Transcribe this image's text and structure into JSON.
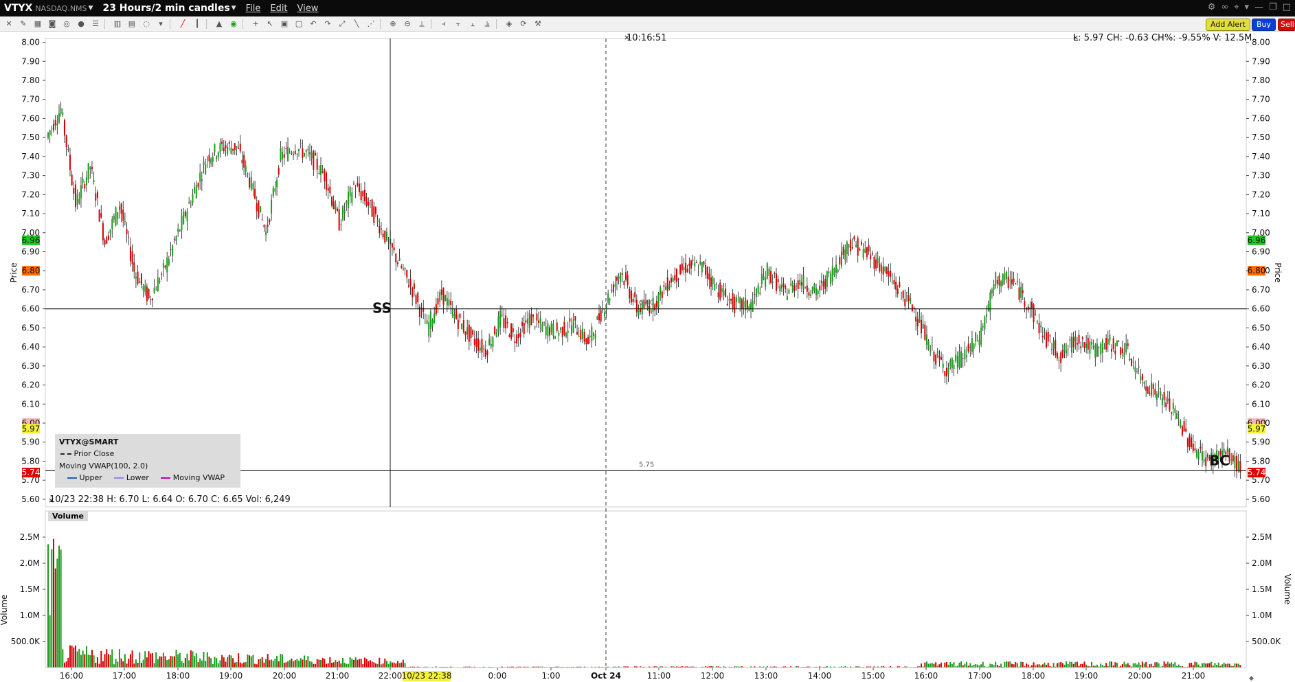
{
  "titlebar": {
    "symbol": "VTYX",
    "exchange": "NASDAQ.NMS",
    "period": "23 Hours/2 min candles",
    "menus": [
      "File",
      "Edit",
      "View"
    ]
  },
  "toolbar": {
    "add_alert": "Add Alert",
    "buy": "Buy",
    "sell": "Sell"
  },
  "chart_info": {
    "top_right": "L: 5.97  CH: -0.63  CH%: -9.55%  V: 12.5M",
    "crosshair_time": "10:16:51",
    "cursor_bar": "10/23 22:38   H: 6.70   L: 6.64   O: 6.70   C: 6.65   Vol: 6,249",
    "cursor_time_label": "10/23 22:38"
  },
  "legend": {
    "title": "VTYX@SMART",
    "prior_close": "Prior Close",
    "vwap": "Moving VWAP(100, 2.0)",
    "upper": "Upper",
    "lower": "Lower",
    "moving_vwap": "Moving VWAP"
  },
  "annotations": {
    "ss": "SS",
    "bc": "BC",
    "line_660": "6.60",
    "line_575": "5.75"
  },
  "price_axis": {
    "label": "Price",
    "ticks": [
      "8.00",
      "7.90",
      "7.80",
      "7.70",
      "7.60",
      "7.50",
      "7.40",
      "7.30",
      "7.20",
      "7.10",
      "7.00",
      "6.90",
      "6.80",
      "6.70",
      "6.60",
      "6.50",
      "6.40",
      "6.30",
      "6.20",
      "6.10",
      "6.00",
      "5.90",
      "5.80",
      "5.70",
      "5.60"
    ],
    "badges": [
      {
        "value": "6.96",
        "color": "#21c521"
      },
      {
        "value": "6.80",
        "color": "#ff6a00"
      },
      {
        "value": "6.00",
        "color": "#f4b6b6"
      },
      {
        "value": "5.97",
        "color": "#f6f23a"
      },
      {
        "value": "5.74",
        "color": "#e00000"
      }
    ]
  },
  "volume_axis": {
    "label": "Volume",
    "panel_label": "Volume",
    "ticks": [
      "2.5M",
      "2.0M",
      "1.5M",
      "1.0M",
      "500.0K"
    ]
  },
  "time_axis": {
    "ticks": [
      "16:00",
      "17:00",
      "18:00",
      "19:00",
      "20:00",
      "21:00",
      "22:00",
      "0:00",
      "1:00",
      "Oct 24",
      "11:00",
      "12:00",
      "13:00",
      "14:00",
      "15:00",
      "16:00",
      "17:00",
      "18:00",
      "19:00",
      "20:00",
      "21:00"
    ]
  },
  "colors": {
    "up": "#1a9b1a",
    "down": "#d40000",
    "background": "#ffffff",
    "titlebar": "#0b0b0b"
  },
  "chart_data": {
    "type": "candlestick",
    "price_range": [
      5.56,
      8.02
    ],
    "volume_range": [
      0,
      3000000
    ],
    "reference_lines": [
      6.6,
      5.75
    ],
    "close_path": [
      {
        "t": "15:40",
        "p": 7.5
      },
      {
        "t": "15:50",
        "p": 7.65
      },
      {
        "t": "16:00",
        "p": 7.15
      },
      {
        "t": "16:20",
        "p": 7.35
      },
      {
        "t": "16:40",
        "p": 6.95
      },
      {
        "t": "17:00",
        "p": 7.15
      },
      {
        "t": "17:10",
        "p": 6.8
      },
      {
        "t": "17:20",
        "p": 6.65
      },
      {
        "t": "17:30",
        "p": 6.8
      },
      {
        "t": "17:40",
        "p": 7.0
      },
      {
        "t": "17:50",
        "p": 7.2
      },
      {
        "t": "18:00",
        "p": 7.4
      },
      {
        "t": "18:30",
        "p": 7.45
      },
      {
        "t": "18:50",
        "p": 7.45
      },
      {
        "t": "19:00",
        "p": 7.25
      },
      {
        "t": "19:10",
        "p": 7.0
      },
      {
        "t": "19:20",
        "p": 7.4
      },
      {
        "t": "19:40",
        "p": 7.45
      },
      {
        "t": "20:00",
        "p": 7.4
      },
      {
        "t": "20:10",
        "p": 7.3
      },
      {
        "t": "20:30",
        "p": 7.05
      },
      {
        "t": "20:40",
        "p": 7.25
      },
      {
        "t": "21:00",
        "p": 7.15
      },
      {
        "t": "21:10",
        "p": 7.0
      },
      {
        "t": "21:30",
        "p": 6.85
      },
      {
        "t": "21:50",
        "p": 6.7
      },
      {
        "t": "22:00",
        "p": 6.5
      },
      {
        "t": "22:20",
        "p": 6.68
      },
      {
        "t": "22:40",
        "p": 6.55
      },
      {
        "t": "22:50",
        "p": 6.45
      },
      {
        "t": "23:20",
        "p": 6.38
      },
      {
        "t": "23:40",
        "p": 6.55
      },
      {
        "t": "0:00",
        "p": 6.45
      },
      {
        "t": "0:20",
        "p": 6.55
      },
      {
        "t": "0:40",
        "p": 6.5
      },
      {
        "t": "1:00",
        "p": 6.48
      },
      {
        "t": "1:30",
        "p": 6.52
      },
      {
        "t": "2:00",
        "p": 6.42
      },
      {
        "t": "Oct 24",
        "p": 6.6
      },
      {
        "t": "10:20",
        "p": 6.8
      },
      {
        "t": "10:40",
        "p": 6.6
      },
      {
        "t": "11:00",
        "p": 6.62
      },
      {
        "t": "11:20",
        "p": 6.75
      },
      {
        "t": "11:40",
        "p": 6.82
      },
      {
        "t": "12:20",
        "p": 6.82
      },
      {
        "t": "12:40",
        "p": 6.7
      },
      {
        "t": "13:00",
        "p": 6.62
      },
      {
        "t": "13:20",
        "p": 6.62
      },
      {
        "t": "13:40",
        "p": 6.8
      },
      {
        "t": "14:00",
        "p": 6.68
      },
      {
        "t": "14:20",
        "p": 6.75
      },
      {
        "t": "14:40",
        "p": 6.68
      },
      {
        "t": "15:00",
        "p": 6.8
      },
      {
        "t": "15:10",
        "p": 6.95
      },
      {
        "t": "15:20",
        "p": 6.9
      },
      {
        "t": "15:40",
        "p": 6.82
      },
      {
        "t": "15:50",
        "p": 6.7
      },
      {
        "t": "16:00",
        "p": 6.6
      },
      {
        "t": "16:10",
        "p": 6.38
      },
      {
        "t": "16:40",
        "p": 6.28
      },
      {
        "t": "17:00",
        "p": 6.35
      },
      {
        "t": "17:20",
        "p": 6.45
      },
      {
        "t": "17:40",
        "p": 6.75
      },
      {
        "t": "18:00",
        "p": 6.75
      },
      {
        "t": "18:10",
        "p": 6.62
      },
      {
        "t": "18:20",
        "p": 6.45
      },
      {
        "t": "18:40",
        "p": 6.35
      },
      {
        "t": "19:00",
        "p": 6.45
      },
      {
        "t": "19:20",
        "p": 6.38
      },
      {
        "t": "19:40",
        "p": 6.42
      },
      {
        "t": "20:00",
        "p": 6.38
      },
      {
        "t": "20:10",
        "p": 6.22
      },
      {
        "t": "20:30",
        "p": 6.15
      },
      {
        "t": "20:50",
        "p": 6.05
      },
      {
        "t": "21:10",
        "p": 5.88
      },
      {
        "t": "21:30",
        "p": 5.8
      },
      {
        "t": "21:50",
        "p": 5.85
      },
      {
        "t": "22:00",
        "p": 5.76
      }
    ]
  }
}
